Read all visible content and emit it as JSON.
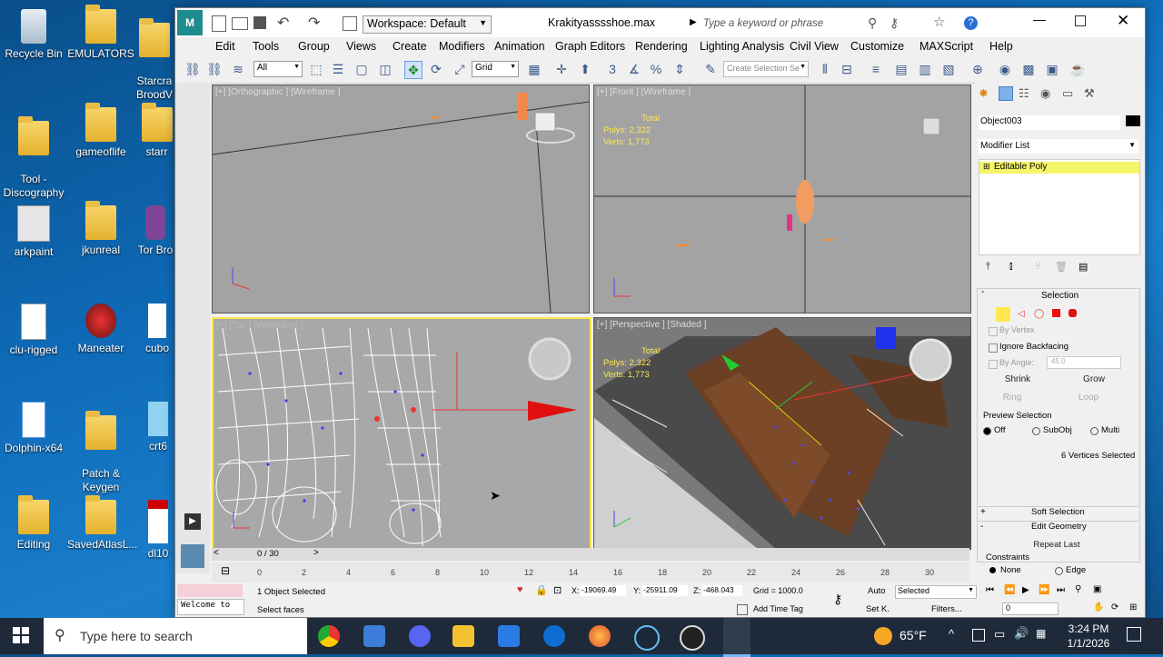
{
  "desktop": {
    "icons": [
      {
        "label": "Recycle Bin"
      },
      {
        "label": "EMULATORS"
      },
      {
        "label": "Starcra\nBroodV"
      },
      {
        "label": "Tool -\nDiscography"
      },
      {
        "label": "gameoflife"
      },
      {
        "label": "starr"
      },
      {
        "label": "arkpaint"
      },
      {
        "label": "jkunreal"
      },
      {
        "label": "Tor Bro"
      },
      {
        "label": "clu-rigged"
      },
      {
        "label": "Maneater"
      },
      {
        "label": "cubo"
      },
      {
        "label": "Dolphin-x64"
      },
      {
        "label": "Patch &\nKeygen"
      },
      {
        "label": "crt6"
      },
      {
        "label": "Editing"
      },
      {
        "label": "SavedAtlasL..."
      },
      {
        "label": "dl10"
      }
    ]
  },
  "window": {
    "title": "Krakityasssshoe.max",
    "workspace": "Workspace: Default",
    "search_placeholder": "Type a keyword or phrase",
    "menu": [
      "Edit",
      "Tools",
      "Group",
      "Views",
      "Create",
      "Modifiers",
      "Animation",
      "Graph Editors",
      "Rendering",
      "Lighting Analysis",
      "Civil View",
      "Customize",
      "MAXScript",
      "Help"
    ],
    "toolbar": {
      "filter": "All",
      "coord": "Grid",
      "selection_set": "Create Selection Se"
    }
  },
  "viewports": {
    "orthographic": {
      "label": "[+] [Orthographic ] [Wireframe ]"
    },
    "front": {
      "label": "[+] [Front ] [Wireframe ]",
      "stats_title": "Total",
      "polys": "Polys:  2,322",
      "verts": "Verts:  1,773"
    },
    "top": {
      "label": "[+] [Top ] [Wireframe ]"
    },
    "perspective": {
      "label": "[+] [Perspective ] [Shaded ]",
      "stats_title": "Total",
      "polys": "Polys:  2,322",
      "verts": "Verts:  1,773"
    }
  },
  "command_panel": {
    "object_name": "Object003",
    "modifier_list": "Modifier List",
    "stack_item": "Editable Poly",
    "selection_header": "Selection",
    "by_vertex": "By Vertex",
    "ignore_backfacing": "Ignore Backfacing",
    "by_angle": "By Angle:",
    "angle_value": "45.0",
    "shrink": "Shrink",
    "grow": "Grow",
    "ring": "Ring",
    "loop": "Loop",
    "preview_selection": "Preview Selection",
    "preview_off": "Off",
    "preview_subobj": "SubObj",
    "preview_multi": "Multi",
    "status": "6 Vertices Selected",
    "soft_selection": "Soft Selection",
    "edit_geometry": "Edit Geometry",
    "repeat_last": "Repeat Last",
    "constraints": "Constraints",
    "c_none": "None",
    "c_edge": "Edge"
  },
  "timeline": {
    "frame": "0 / 30",
    "ticks": [
      "0",
      "2",
      "4",
      "6",
      "8",
      "10",
      "12",
      "14",
      "16",
      "18",
      "20",
      "22",
      "24",
      "26",
      "28",
      "30"
    ]
  },
  "status": {
    "maxscript": "Welcome to",
    "selected": "1 Object Selected",
    "prompt": "Select faces",
    "x": "-19069.49",
    "y": "-25911.09",
    "z": "-468.043",
    "grid": "Grid = 1000.0",
    "add_time_tag": "Add Time Tag",
    "auto": "Auto",
    "set_key": "Set K.",
    "selected_dropdown": "Selected",
    "filters": "Filters...",
    "frame_field": "0"
  },
  "taskbar": {
    "search_placeholder": "Type here to search",
    "weather": "65°F",
    "time": "3:24 PM",
    "date": "1/1/2026"
  }
}
